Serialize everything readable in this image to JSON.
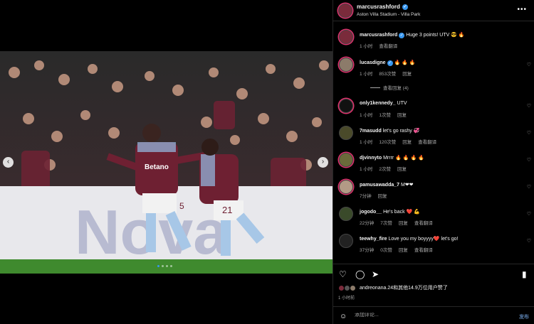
{
  "post": {
    "username": "marcusrashford",
    "location": "Aston Villa Stadium - Villa Park",
    "caption_text": "Huge 3 points! UTV 😎 🔥",
    "caption_time": "1 小时",
    "see_translation": "查看翻译",
    "likes_text": "andreonana.24和其他14.9万位用户赞了",
    "time": "1 小时前",
    "add_comment_placeholder": "添加评论...",
    "post_label": "发布"
  },
  "photo": {
    "shirt_sponsor": "Betano",
    "board_text": "Nova",
    "player_number_left": "5",
    "player_number_right": "21"
  },
  "comments": [
    {
      "user": "lucasdigne",
      "verified": true,
      "text": "🔥 🔥 🔥",
      "time": "1 小时",
      "likes": "853次赞",
      "reply": "回复"
    },
    {
      "user": "only1kennedy_",
      "text": "UTV",
      "time": "1 小时",
      "likes": "1次赞",
      "reply": "回复"
    },
    {
      "user": "7masudd",
      "text": "let's go rashy 💞",
      "time": "1 小时",
      "likes": "120次赞",
      "reply": "回复",
      "translate": "查看翻译"
    },
    {
      "user": "djvinnyto",
      "text": "Mrrrr 🔥 🔥 🔥 🔥",
      "time": "1 小时",
      "likes": "2次赞",
      "reply": "回复"
    },
    {
      "user": "pamusawadda_7",
      "text": "M❤❤",
      "time": "7分钟",
      "reply": "回复"
    },
    {
      "user": "jogodo__",
      "text": "He's back ❤️ 💪",
      "time": "22分钟",
      "likes": "7次赞",
      "reply": "回复",
      "translate": "查看翻译"
    },
    {
      "user": "teewhy_fire",
      "text": "Love you my boyyyy❤️ let's go!",
      "time": "37分钟",
      "likes": "0次赞",
      "reply": "回复",
      "translate": "查看翻译"
    }
  ],
  "view_replies": "查看回复 (4)",
  "icons": {
    "more": "more-options-icon",
    "like": "heart-icon",
    "comment": "comment-icon",
    "share": "share-icon",
    "save": "bookmark-icon",
    "emoji": "emoji-icon"
  },
  "colors": {
    "accent": "#3897f0",
    "pitch": "#3f8a2e",
    "claret": "#7a2b3b"
  }
}
